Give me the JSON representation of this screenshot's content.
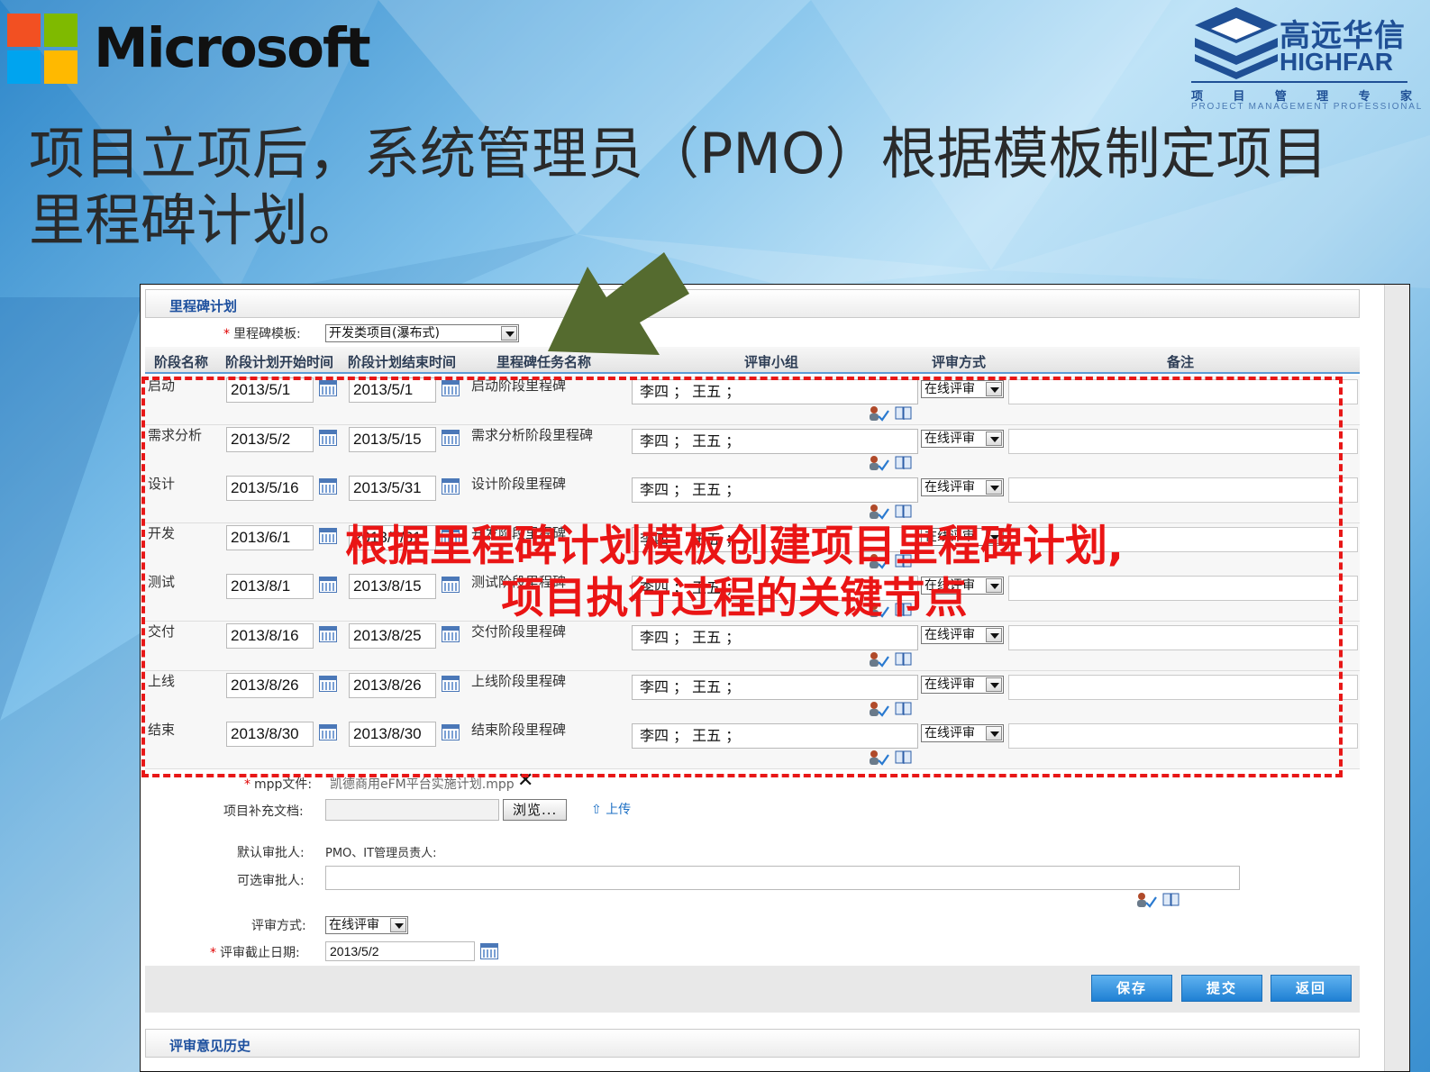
{
  "header": {
    "ms_brand": "Microsoft",
    "hf_cn": "高远华信",
    "hf_en": "HIGHFAR",
    "hf_chars": [
      "项",
      "目",
      "管",
      "理",
      "专",
      "家"
    ],
    "hf_en_sub": "PROJECT MANAGEMENT PROFESSIONAL"
  },
  "slide_title": "项目立项后，系统管理员（PMO）根据模板制定项目里程碑计划。",
  "form": {
    "section_title": "里程碑计划",
    "template_label": "里程碑模板:",
    "template_value": "开发类项目(瀑布式)",
    "columns": [
      "阶段名称",
      "阶段计划开始时间",
      "阶段计划结束时间",
      "里程碑任务名称",
      "评审小组",
      "评审方式",
      "备注"
    ],
    "rows": [
      {
        "name": "启动",
        "start": "2013/5/1",
        "end": "2013/5/1",
        "task": "启动阶段里程碑",
        "group": "李四 ； 王五 ；",
        "method": "在线评审"
      },
      {
        "name": "需求分析",
        "start": "2013/5/2",
        "end": "2013/5/15",
        "task": "需求分析阶段里程碑",
        "group": "李四 ； 王五 ；",
        "method": "在线评审"
      },
      {
        "name": "设计",
        "start": "2013/5/16",
        "end": "2013/5/31",
        "task": "设计阶段里程碑",
        "group": "李四 ； 王五 ；",
        "method": "在线评审"
      },
      {
        "name": "开发",
        "start": "2013/6/1",
        "end": "2013/7/31",
        "task": "开发阶段里程碑",
        "group": "李四 ； 王五 ；",
        "method": "在线评审"
      },
      {
        "name": "测试",
        "start": "2013/8/1",
        "end": "2013/8/15",
        "task": "测试阶段里程碑",
        "group": "李四 ； 王五 ；",
        "method": "在线评审"
      },
      {
        "name": "交付",
        "start": "2013/8/16",
        "end": "2013/8/25",
        "task": "交付阶段里程碑",
        "group": "李四 ； 王五 ；",
        "method": "在线评审"
      },
      {
        "name": "上线",
        "start": "2013/8/26",
        "end": "2013/8/26",
        "task": "上线阶段里程碑",
        "group": "李四 ； 王五 ；",
        "method": "在线评审"
      },
      {
        "name": "结束",
        "start": "2013/8/30",
        "end": "2013/8/30",
        "task": "结束阶段里程碑",
        "group": "李四 ； 王五 ；",
        "method": "在线评审"
      }
    ],
    "mpp_label": "mpp文件:",
    "mpp_value": "凯德商用eFM平台实施计划.mpp",
    "supp_label": "项目补充文档:",
    "browse_label": "浏览...",
    "upload_label": "上传",
    "default_approver_label": "默认审批人:",
    "default_approver_value": "PMO、IT管理员责人:",
    "optional_approver_label": "可选审批人:",
    "review_method_label": "评审方式:",
    "review_method_value": "在线评审",
    "deadline_label": "评审截止日期:",
    "deadline_value": "2013/5/2",
    "buttons": {
      "save": "保存",
      "submit": "提交",
      "back": "返回"
    },
    "history_title": "评审意见历史"
  },
  "overlay": {
    "line1": "根据里程碑计划模板创建项目里程碑计划,",
    "line2": "项目执行过程的关键节点"
  },
  "colors": {
    "ms_red": "#f25022",
    "ms_green": "#7fba00",
    "ms_blue": "#00a4ef",
    "ms_yellow": "#ffb900",
    "highfar_blue": "#1f4f95",
    "annotation_red": "#e81717",
    "arrow_green": "#556b2f"
  }
}
